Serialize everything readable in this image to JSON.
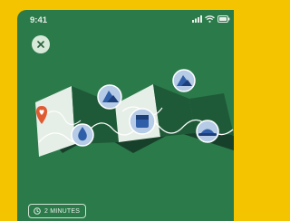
{
  "status_bar": {
    "time": "9:41",
    "icons": [
      "signal-icon",
      "wifi-icon",
      "battery-icon"
    ]
  },
  "close_button": {
    "icon": "close-icon"
  },
  "illustration": {
    "subject": "folded-map-icon",
    "markers": [
      "map-pin-icon",
      "water-drop-icon",
      "mountain-icon",
      "cube-icon",
      "mountain-icon",
      "hat-icon"
    ]
  },
  "duration": {
    "icon": "clock-icon",
    "label": "2 MINUTES"
  },
  "colors": {
    "background": "#f5c400",
    "screen": "#2b7a4a",
    "map_paper": "#e6efe7",
    "marker": "#b5cbe6",
    "pin": "#e05a32"
  }
}
